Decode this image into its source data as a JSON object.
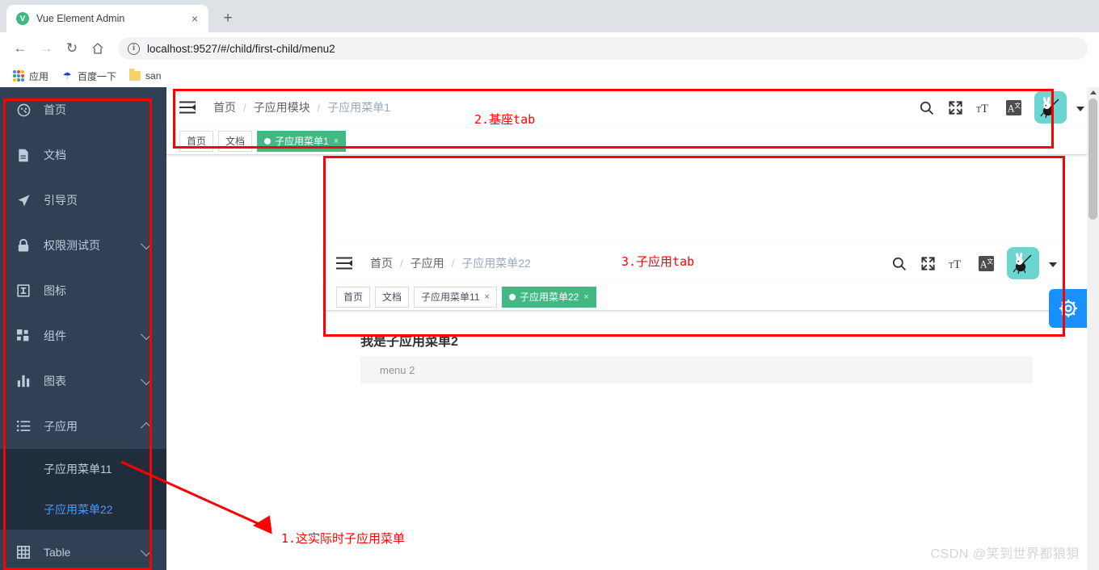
{
  "browser": {
    "tab": {
      "title": "Vue Element Admin",
      "favicon_letter": "V",
      "close_label": "×"
    },
    "new_tab_label": "+",
    "nav": {
      "back": "←",
      "forward": "→",
      "reload": "↻",
      "home": "⌂",
      "url": "localhost:9527/#/child/first-child/menu2",
      "info_icon": "i"
    },
    "bookmarks": [
      {
        "icon": "apps-grid-icon",
        "label": "应用"
      },
      {
        "icon": "baidu-icon",
        "label": "百度一下"
      },
      {
        "icon": "folder-icon",
        "label": "san"
      }
    ]
  },
  "sidebar": {
    "items": [
      {
        "label": "首页",
        "icon": "dashboard-icon",
        "has_caret": false,
        "active": false
      },
      {
        "label": "文档",
        "icon": "document-icon",
        "has_caret": false,
        "active": false
      },
      {
        "label": "引导页",
        "icon": "guide-icon",
        "has_caret": false,
        "active": false
      },
      {
        "label": "权限测试页",
        "icon": "lock-icon",
        "has_caret": true,
        "active": false
      },
      {
        "label": "图标",
        "icon": "icon-icon",
        "has_caret": false,
        "active": false
      },
      {
        "label": "组件",
        "icon": "component-icon",
        "has_caret": true,
        "active": false
      },
      {
        "label": "图表",
        "icon": "chart-icon",
        "has_caret": true,
        "active": false
      },
      {
        "label": "子应用",
        "icon": "list-icon",
        "has_caret": true,
        "expanded": true,
        "active": false
      },
      {
        "label": "Table",
        "icon": "table-icon",
        "has_caret": true,
        "active": false
      }
    ],
    "submenu": [
      {
        "label": "子应用菜单11",
        "active": false
      },
      {
        "label": "子应用菜单22",
        "active": true
      }
    ]
  },
  "outer_app": {
    "breadcrumb": [
      {
        "label": "首页",
        "muted": false
      },
      {
        "label": "子应用模块",
        "muted": false
      },
      {
        "label": "子应用菜单1",
        "muted": true
      }
    ],
    "separator": "/",
    "nav_icons": [
      {
        "name": "search-icon",
        "glyph": "⚲"
      },
      {
        "name": "fullscreen-icon",
        "glyph": "⛶"
      },
      {
        "name": "font-size-icon",
        "glyph": "T"
      },
      {
        "name": "translate-icon",
        "glyph": "A"
      }
    ],
    "avatar_name": "avatar",
    "tags": [
      {
        "label": "首页",
        "active": false,
        "closable": false
      },
      {
        "label": "文档",
        "active": false,
        "closable": false
      },
      {
        "label": "子应用菜单1",
        "active": true,
        "closable": true
      }
    ],
    "close_glyph": "×"
  },
  "child_app": {
    "breadcrumb": [
      {
        "label": "首页",
        "muted": false
      },
      {
        "label": "子应用",
        "muted": false
      },
      {
        "label": "子应用菜单22",
        "muted": true
      }
    ],
    "separator": "/",
    "tags": [
      {
        "label": "首页",
        "active": false,
        "closable": false
      },
      {
        "label": "文档",
        "active": false,
        "closable": false
      },
      {
        "label": "子应用菜单11",
        "active": false,
        "closable": true
      },
      {
        "label": "子应用菜单22",
        "active": true,
        "closable": true
      }
    ],
    "close_glyph": "×",
    "title": "我是子应用菜单2",
    "panel_text": "menu 2"
  },
  "settings_button": {
    "name": "settings-gear-button"
  },
  "annotations": [
    {
      "id": "a1",
      "text": "1.这实际时子应用菜单"
    },
    {
      "id": "a2",
      "text": "2.基座tab"
    },
    {
      "id": "a3",
      "text": "3.子应用tab"
    }
  ],
  "watermark": "CSDN @笑到世界都狼狽",
  "colors": {
    "sidebar_bg": "#304156",
    "submenu_bg": "#1f2d3d",
    "tag_active": "#42b983",
    "accent_blue": "#409eff",
    "annotation_red": "#ff0000",
    "avatar_bg": "#6ad6cf",
    "settings_blue": "#1890ff"
  }
}
